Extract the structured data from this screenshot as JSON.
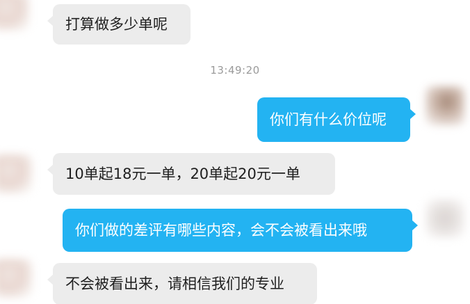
{
  "conversation": {
    "messages": [
      {
        "from": "other",
        "text": "打算做多少单呢"
      },
      {
        "from": "me",
        "text": "你们有什么价位呢"
      },
      {
        "from": "other",
        "text": "10单起18元一单，20单起20元一单"
      },
      {
        "from": "me",
        "text": "你们做的差评有哪些内容，会不会被看出来哦"
      },
      {
        "from": "other",
        "text": "不会被看出来，请相信我们的专业"
      }
    ],
    "timestamp": "13:49:20"
  },
  "colors": {
    "incoming_bubble": "#ececec",
    "outgoing_bubble": "#23b3f2",
    "incoming_text": "#1f1f1f",
    "outgoing_text": "#ffffff",
    "timestamp_text": "#9a9a9a"
  }
}
